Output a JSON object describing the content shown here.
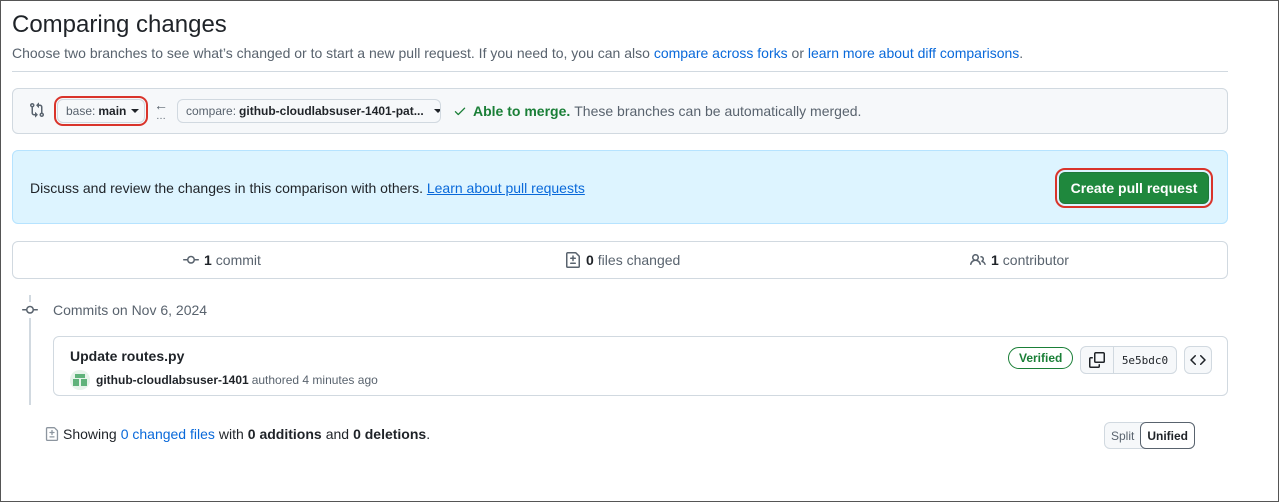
{
  "header": {
    "title": "Comparing changes",
    "subtitle_prefix": "Choose two branches to see what’s changed or to start a new pull request. If you need to, you can also",
    "compare_forks_link": "compare across forks",
    "subtitle_or": "or",
    "learn_diff_link": "learn more about diff comparisons",
    "subtitle_end": "."
  },
  "range": {
    "base_prefix": "base:",
    "base_branch": "main",
    "compare_prefix": "compare:",
    "compare_branch": "github-cloudlabsuser-1401-pat...",
    "merge_ok": "Able to merge.",
    "merge_message": "These branches can be automatically merged."
  },
  "discuss": {
    "text": "Discuss and review the changes in this comparison with others.",
    "learn_link": "Learn about pull requests",
    "create_button": "Create pull request"
  },
  "summary": {
    "commits_count": "1",
    "commits_label": "commit",
    "files_count": "0",
    "files_label": "files changed",
    "contributors_count": "1",
    "contributors_label": "contributor"
  },
  "commits": {
    "date_heading": "Commits on Nov 6, 2024",
    "items": [
      {
        "title": "Update routes.py",
        "author": "github-cloudlabsuser-1401",
        "authored": "authored 4 minutes ago",
        "badge": "Verified",
        "sha": "5e5bdc0"
      }
    ]
  },
  "toc": {
    "showing": "Showing",
    "changed_files_link": "0 changed files",
    "with": "with",
    "additions": "0 additions",
    "and": "and",
    "deletions": "0 deletions",
    "period": "."
  },
  "diff_view": {
    "split": "Split",
    "unified": "Unified",
    "selected": "Unified"
  },
  "colors": {
    "accent_link": "#0969da",
    "success": "#1a7f37",
    "primary_button": "#1f883d",
    "info_bg": "#ddf4ff",
    "highlight_outline": "#d9342b"
  }
}
